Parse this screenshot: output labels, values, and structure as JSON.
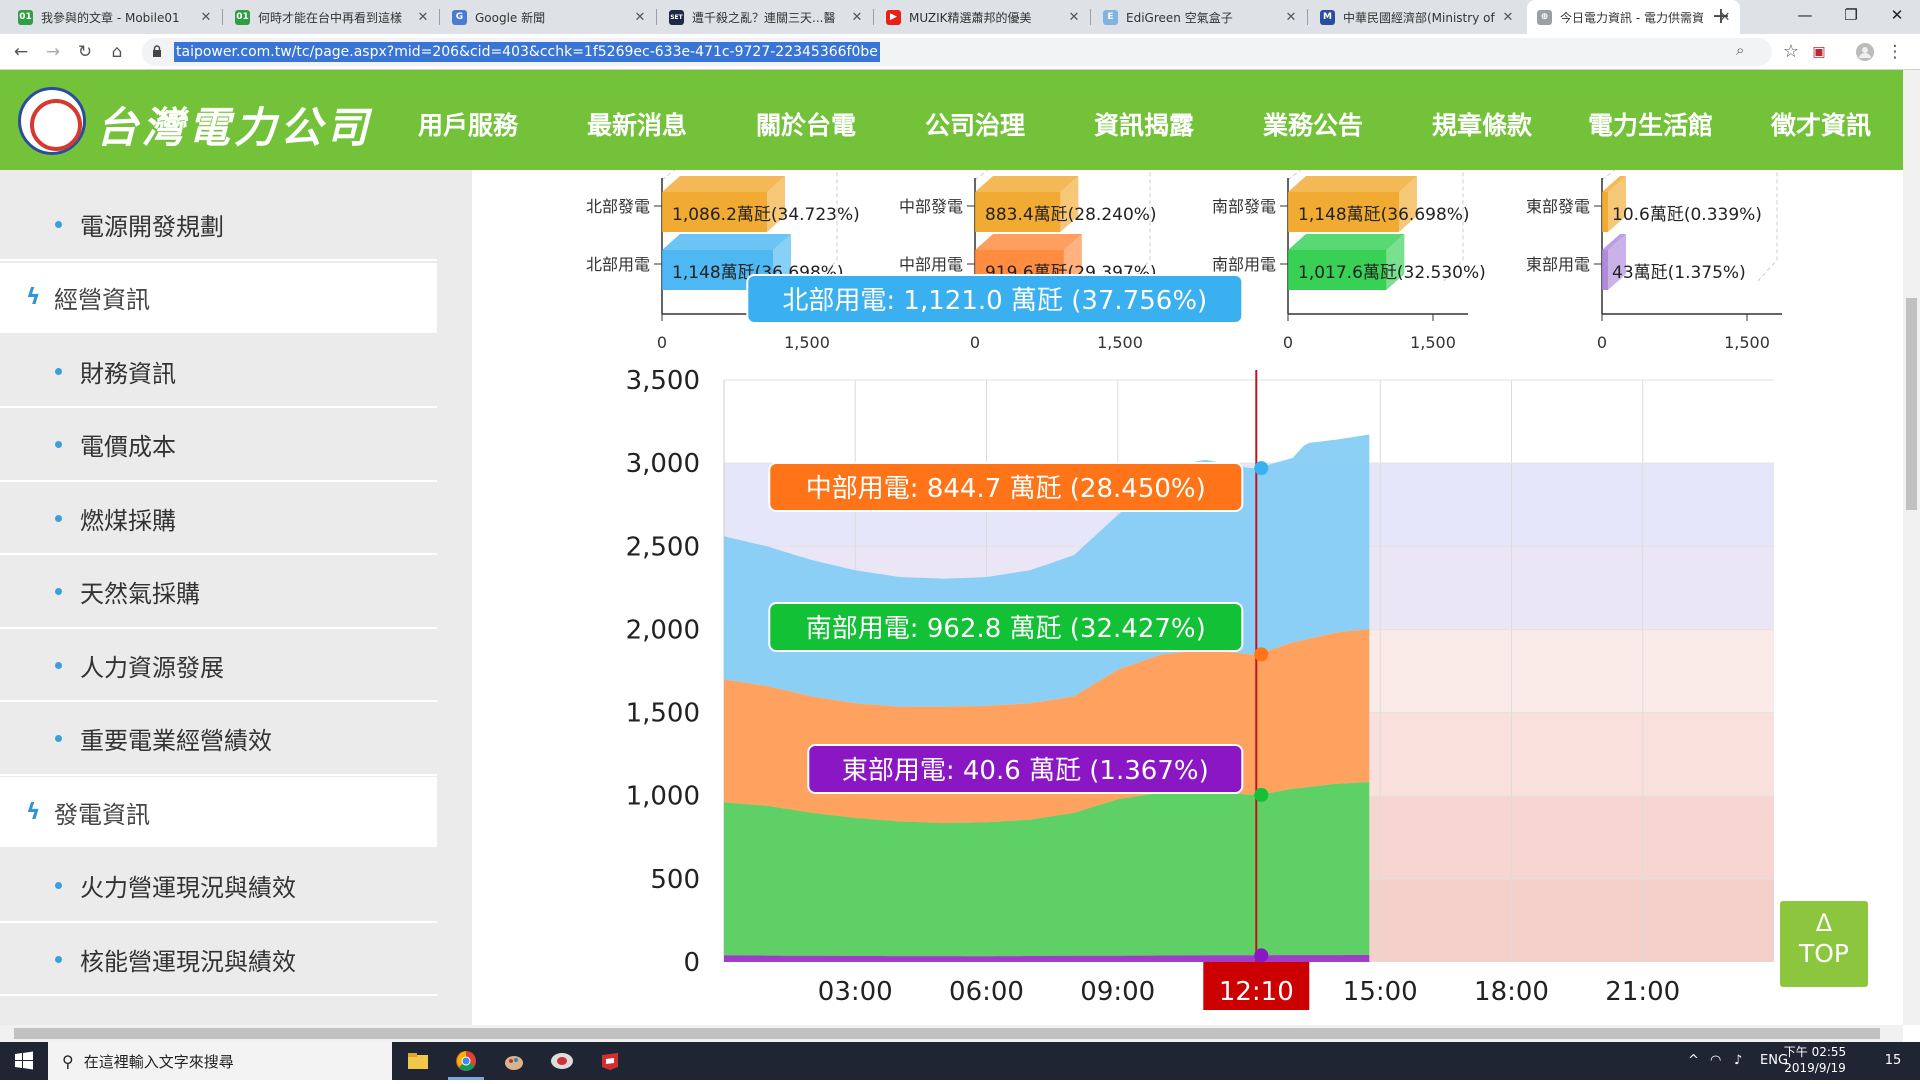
{
  "browser": {
    "tabs": [
      {
        "title": "我參與的文章 - Mobile01",
        "favicon_color": "#2f9e44",
        "favicon_glyph": "01"
      },
      {
        "title": "何時才能在台中再看到這樣",
        "favicon_color": "#2f9e44",
        "favicon_glyph": "01"
      },
      {
        "title": "Google 新聞",
        "favicon_color": "#4a7bd0",
        "favicon_glyph": "G"
      },
      {
        "title": "遭千殺之亂？連關三天...醫",
        "favicon_color": "#1e2a44",
        "favicon_glyph": "SET"
      },
      {
        "title": "MUZIK精選蕭邦的優美",
        "favicon_color": "#e62117",
        "favicon_glyph": "▶"
      },
      {
        "title": "EdiGreen 空氣盒子",
        "favicon_color": "#7fb3e0",
        "favicon_glyph": "E"
      },
      {
        "title": "中華民國經濟部(Ministry of",
        "favicon_color": "#2b4da0",
        "favicon_glyph": "M"
      },
      {
        "title": "今日電力資訊 - 電力供需資",
        "favicon_color": "#9aa0a6",
        "favicon_glyph": "⊕"
      }
    ],
    "new_tab": "+",
    "window_controls": [
      "—",
      "❐",
      "✕"
    ],
    "nav": {
      "back": "←",
      "forward": "→",
      "reload": "↻",
      "home": "⌂"
    },
    "url": "taipower.com.tw/tc/page.aspx?mid=206&cid=403&cchk=1f5269ec-633e-471c-9727-22345366f0be",
    "omni_icons": [
      "zoom-icon",
      "star-icon",
      "extension-icon",
      "profile-icon",
      "menu-icon"
    ]
  },
  "site": {
    "logo_text": "台灣電力公司",
    "nav": [
      "用戶服務",
      "最新消息",
      "關於台電",
      "公司治理",
      "資訊揭露",
      "業務公告",
      "規章條款",
      "電力生活館",
      "徵才資訊"
    ],
    "active_nav_index": 4,
    "brand_green": "#73c23a"
  },
  "sidebar": {
    "items": [
      {
        "label": "電源開發規劃",
        "type": "sub"
      },
      {
        "label": "經營資訊",
        "type": "category"
      },
      {
        "label": "財務資訊",
        "type": "sub"
      },
      {
        "label": "電價成本",
        "type": "sub"
      },
      {
        "label": "燃煤採購",
        "type": "sub"
      },
      {
        "label": "天然氣採購",
        "type": "sub"
      },
      {
        "label": "人力資源發展",
        "type": "sub"
      },
      {
        "label": "重要電業經營績效",
        "type": "sub"
      },
      {
        "label": "發電資訊",
        "type": "category"
      },
      {
        "label": "火力營運現況與績效",
        "type": "sub"
      },
      {
        "label": "核能營運現況與績效",
        "type": "sub"
      }
    ]
  },
  "top_button": {
    "arrow": "Δ",
    "label": "TOP"
  },
  "chart_data": [
    {
      "type": "bar",
      "region_panels": [
        {
          "rows": [
            {
              "label": "北部發電",
              "value": 1086.2,
              "text": "1,086.2萬瓩(34.723%)",
              "color": "#f0a21d"
            },
            {
              "label": "北部用電",
              "value": 1148,
              "text": "1,148萬瓩(36.698%)",
              "color": "#3ab0f0"
            }
          ]
        },
        {
          "rows": [
            {
              "label": "中部發電",
              "value": 883.4,
              "text": "883.4萬瓩(28.240%)",
              "color": "#f0a21d"
            },
            {
              "label": "中部用電",
              "value": 919.6,
              "text": "919.6萬瓩(29.397%)",
              "color": "#ff7f2a"
            }
          ]
        },
        {
          "rows": [
            {
              "label": "南部發電",
              "value": 1148,
              "text": "1,148萬瓩(36.698%)",
              "color": "#f0a21d"
            },
            {
              "label": "南部用電",
              "value": 1017.6,
              "text": "1,017.6萬瓩(32.530%)",
              "color": "#22cc44"
            }
          ]
        },
        {
          "rows": [
            {
              "label": "東部發電",
              "value": 10.6,
              "text": "10.6萬瓩(0.339%)",
              "color": "#f0a21d"
            },
            {
              "label": "東部用電",
              "value": 43,
              "text": "43萬瓩(1.375%)",
              "color": "#a67ed8"
            }
          ]
        }
      ],
      "x_ticks": [
        "0",
        "1,500"
      ],
      "xlim": [
        0,
        2000
      ]
    },
    {
      "type": "area",
      "stacked": true,
      "x_ticks": [
        "03:00",
        "06:00",
        "09:00",
        "12:10",
        "15:00",
        "18:00",
        "21:00"
      ],
      "x_tick_hours": [
        3,
        6,
        9,
        12.1667,
        15,
        18,
        21
      ],
      "current_time_label": "12:10",
      "current_time_hour": 12.1667,
      "y_ticks": [
        "3,500",
        "3,000",
        "2,500",
        "2,000",
        "1,500",
        "1,000",
        "500",
        "0"
      ],
      "ylim": [
        0,
        3500
      ],
      "xlim": [
        0,
        24
      ],
      "data_end_hour": 14.75,
      "series": [
        {
          "name": "東部用電",
          "color": "#9b33c9",
          "hours": [
            0,
            3,
            6,
            9,
            12,
            14.75
          ],
          "values": [
            40,
            36,
            35,
            38,
            41,
            42
          ]
        },
        {
          "name": "南部用電",
          "color": "#55d05f",
          "hours": [
            0,
            1,
            2,
            3,
            4,
            5,
            6,
            7,
            8,
            9,
            10,
            11,
            12,
            12.17,
            13,
            14,
            14.75
          ],
          "values": [
            920,
            900,
            860,
            830,
            810,
            800,
            805,
            820,
            860,
            940,
            980,
            990,
            965,
            963,
            1000,
            1030,
            1040
          ]
        },
        {
          "name": "中部用電",
          "color": "#ff9e58",
          "hours": [
            0,
            1,
            2,
            3,
            4,
            5,
            6,
            7,
            8,
            9,
            10,
            11,
            12,
            12.17,
            13,
            14,
            14.75
          ],
          "values": [
            740,
            720,
            700,
            690,
            690,
            700,
            700,
            700,
            700,
            780,
            830,
            850,
            845,
            845,
            880,
            910,
            920
          ]
        },
        {
          "name": "北部用電",
          "color": "#86cdf5",
          "hours": [
            0,
            1,
            2,
            3,
            4,
            5,
            6,
            7,
            8,
            9,
            9.5,
            10,
            11,
            12,
            12.17,
            13,
            13.3,
            14,
            14.75
          ],
          "values": [
            860,
            840,
            820,
            800,
            780,
            770,
            775,
            800,
            850,
            930,
            1000,
            1120,
            1140,
            1120,
            1121,
            1110,
            1180,
            1160,
            1170
          ]
        }
      ],
      "tooltips": [
        {
          "series": "北部用電",
          "text": "北部用電: 1,121.0 萬瓩 (37.756%)",
          "color": "#3ab0f0",
          "marker_value": 2970
        },
        {
          "series": "中部用電",
          "text": "中部用電: 844.7 萬瓩 (28.450%)",
          "color": "#ff7418",
          "marker_value": 1850
        },
        {
          "series": "南部用電",
          "text": "南部用電: 962.8 萬瓩 (32.427%)",
          "color": "#12c135",
          "marker_value": 1005
        },
        {
          "series": "東部用電",
          "text": "東部用電: 40.6 萬瓩 (1.367%)",
          "color": "#8a16c4",
          "marker_value": 40
        }
      ],
      "background_bands": [
        {
          "from": 3000,
          "to": 2500,
          "color": "#e6e6fa"
        },
        {
          "from": 2500,
          "to": 2000,
          "color": "#ebe6f6"
        },
        {
          "from": 2000,
          "to": 1500,
          "color": "#fbebe8"
        },
        {
          "from": 1500,
          "to": 1000,
          "color": "#f9e0dc"
        },
        {
          "from": 1000,
          "to": 500,
          "color": "#f7d6d1"
        },
        {
          "from": 500,
          "to": 0,
          "color": "#f5cfca"
        }
      ]
    }
  ],
  "taskbar": {
    "search_placeholder": "在這裡輸入文字來搜尋",
    "apps": [
      "file-explorer-icon",
      "chrome-icon",
      "paint-icon",
      "app-icon",
      "red-app-icon"
    ],
    "tray": {
      "lang": "ENG",
      "time": "下午 02:55",
      "date": "2019/9/19",
      "notifications": "15"
    }
  }
}
